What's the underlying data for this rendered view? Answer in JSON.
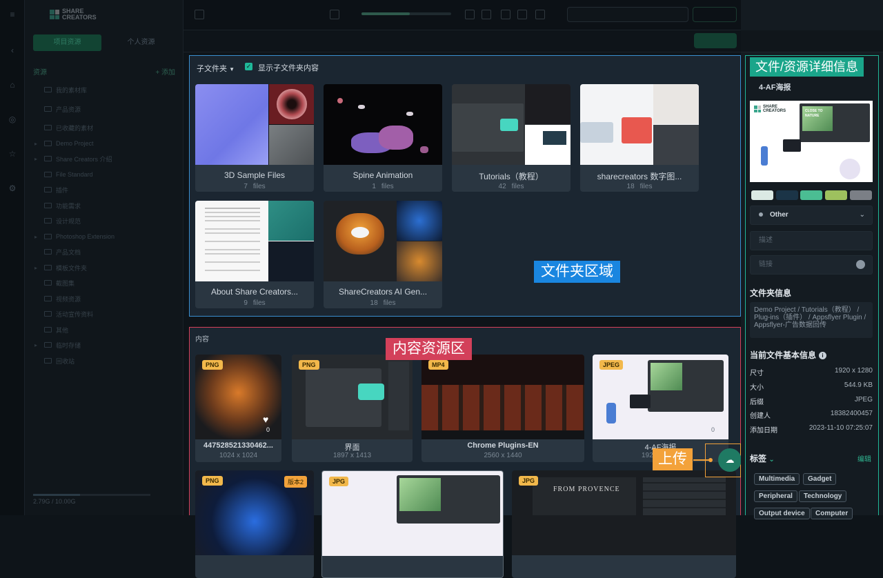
{
  "app": {
    "logo_line1": "SHARE",
    "logo_line2": "CREATORS"
  },
  "sidebar": {
    "tabs": [
      "项目资源",
      "个人资源"
    ],
    "header": "资源",
    "header_action": "+ 添加",
    "items": [
      "我的素材库",
      "产品资源",
      "已收藏的素材",
      "Demo Project",
      "Share Creators 介绍",
      "File Standard",
      "插件",
      "功能需求",
      "设计规范",
      "Photoshop Extension",
      "产品文档",
      "模板文件夹",
      "截图集",
      "视频资源",
      "活动宣传资料",
      "其他",
      "临时存储",
      "回收站"
    ],
    "storage_text": "2.79G / 10.00G"
  },
  "folder_section": {
    "subfolder_label": "子文件夹",
    "show_sub_label": "显示子文件夹内容",
    "files_word": "files",
    "folders": [
      {
        "name": "3D Sample Files",
        "count": "7"
      },
      {
        "name": "Spine Animation",
        "count": "1"
      },
      {
        "name": "Tutorials（教程）",
        "count": "42"
      },
      {
        "name": "sharecreators 数字图...",
        "count": "18"
      },
      {
        "name": "About Share Creators...",
        "count": "9"
      },
      {
        "name": "ShareCreators AI Gen...",
        "count": "18"
      }
    ]
  },
  "content_section": {
    "label": "内容",
    "assets": [
      {
        "type": "PNG",
        "name": "447528521330462...",
        "dims": "1024 x 1024",
        "likes": "0"
      },
      {
        "type": "PNG",
        "name": "界面",
        "dims": "1897 x 1413"
      },
      {
        "type": "MP4",
        "name": "Chrome Plugins-EN",
        "dims": "2560 x 1440"
      },
      {
        "type": "JPEG",
        "name": "4-AF海报",
        "dims": "1920 x 1280",
        "likes": "0"
      },
      {
        "type": "PNG",
        "version": "版本2"
      },
      {
        "type": "JPG"
      },
      {
        "type": "JPG",
        "thumb_text": "FROM PROVENCE"
      }
    ]
  },
  "annotations": {
    "folder_area": "文件夹区域",
    "content_area": "内容资源区",
    "detail_area": "文件/资源详细信息",
    "upload": "上传"
  },
  "detail": {
    "title": "4-AF海报",
    "preview_text": "CLOSE TO NATURE",
    "palette": [
      "#dbe9e4",
      "#1b3447",
      "#4bbd93",
      "#9ec15e",
      "#7b7f86"
    ],
    "category": "Other",
    "desc_placeholder": "描述",
    "link_placeholder": "链接",
    "folder_info_title": "文件夹信息",
    "path": "Demo Project / Tutorials（教程） / Plug-ins（插件） / Appsflyer Plugin / Appsflyer-广告数据回传",
    "basic_info_title": "当前文件基本信息",
    "info": [
      {
        "k": "尺寸",
        "v": "1920 x 1280"
      },
      {
        "k": "大小",
        "v": "544.9 KB"
      },
      {
        "k": "后缀",
        "v": "JPEG"
      },
      {
        "k": "创建人",
        "v": "18382400457"
      },
      {
        "k": "添加日期",
        "v": "2023-11-10 07:25:07"
      }
    ],
    "tags_title": "标签",
    "tags_edit": "编辑",
    "tags": [
      "Multimedia",
      "Gadget",
      "Peripheral",
      "Technology",
      "Output device",
      "Computer"
    ]
  }
}
